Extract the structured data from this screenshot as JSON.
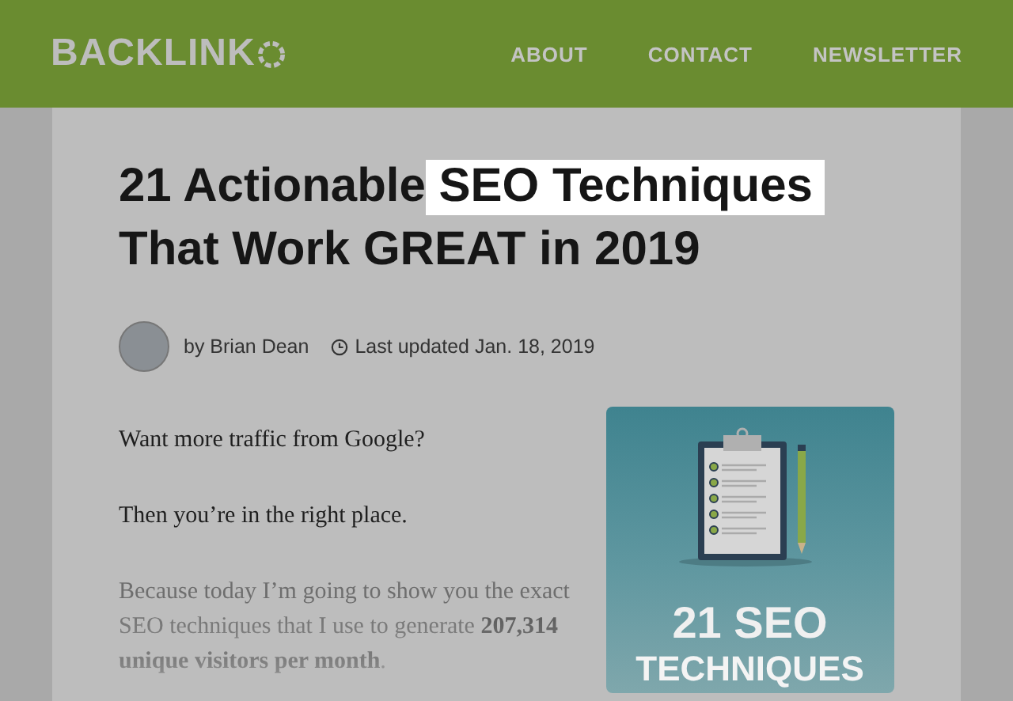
{
  "header": {
    "logo": "BACKLINK",
    "nav": [
      {
        "label": "ABOUT"
      },
      {
        "label": "CONTACT"
      },
      {
        "label": "NEWSLETTER"
      }
    ]
  },
  "article": {
    "title": [
      {
        "text": "21 Actionable ",
        "highlighted": false
      },
      {
        "text": "SEO Techniques",
        "highlighted": true
      },
      {
        "text": "That Work GREAT in 2019",
        "highlighted": false
      }
    ],
    "author": "by Brian Dean",
    "updated": "Last updated Jan. 18, 2019",
    "paragraphs": [
      "Want more traffic from Google?",
      "Then you’re in the right place.",
      "Because today I’m going to show you the exact SEO techniques that I use to generate **207,314 unique visitors per month**."
    ],
    "image": {
      "line_1": "21 SEO",
      "line_2": "TECHNIQUES"
    }
  }
}
